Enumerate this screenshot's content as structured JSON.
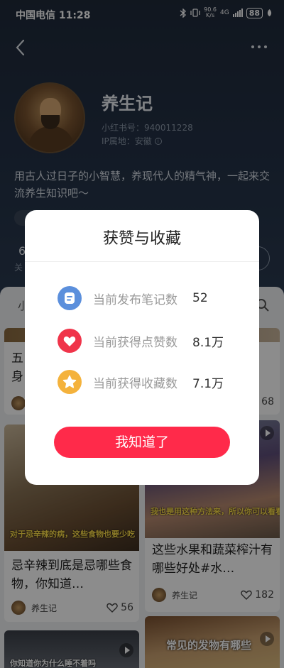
{
  "status_bar": {
    "carrier": "中国电信",
    "time": "11:28",
    "net_speed": "90.6",
    "net_unit": "K/s",
    "net_type": "4G",
    "battery": "88"
  },
  "profile": {
    "name": "养生记",
    "id_line": "小红书号：940011228",
    "ip_line": "IP属地：安徽",
    "bio": "用古人过日子的小智慧，养现代人的精气神，一起来交流养生知识吧～",
    "stat_num": "6",
    "stat_label": "关"
  },
  "feed": {
    "tab_label": "小",
    "cards": [
      {
        "title": "五",
        "title2": "身"
      },
      {
        "likes": "68"
      },
      {
        "title": "忌辛辣到底是忌哪些食物，你知道…",
        "author": "养生记",
        "likes": "56",
        "caption": "对于忌辛辣的病，这些食物也要少吃"
      },
      {
        "title": "这些水果和蔬菜榨汁有哪些好处#水…",
        "author": "养生记",
        "likes": "182",
        "caption": "我也是用这种方法来，所以你可以看看"
      },
      {
        "caption": "你知道你为什么睡不着吗"
      },
      {
        "caption": "常见的发物有哪些"
      }
    ]
  },
  "modal": {
    "title": "获赞与收藏",
    "rows": [
      {
        "label": "当前发布笔记数",
        "value": "52",
        "icon": "note-icon",
        "color": "#5b8fdc"
      },
      {
        "label": "当前获得点赞数",
        "value": "8.1万",
        "icon": "heart-icon",
        "color": "#f0344a"
      },
      {
        "label": "当前获得收藏数",
        "value": "7.1万",
        "icon": "star-icon",
        "color": "#f4b23c"
      }
    ],
    "ok_label": "我知道了",
    "accent": "#ff2a4a"
  }
}
